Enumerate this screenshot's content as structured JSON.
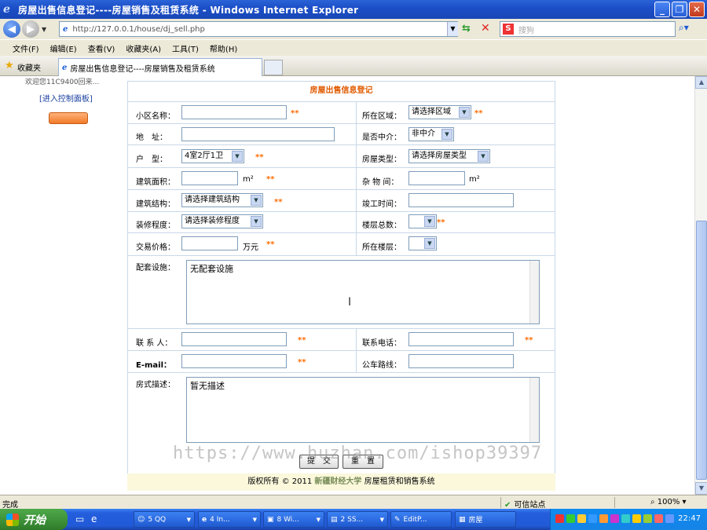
{
  "window": {
    "title": "房屋出售信息登记----房屋销售及租赁系统 - Windows Internet Explorer",
    "controls": [
      "_",
      "❐",
      "✕"
    ]
  },
  "toolbar": {
    "address": "http://127.0.0.1/house/dj_sell.php",
    "search_placeholder": "搜狗"
  },
  "menu": {
    "items": [
      "文件(F)",
      "编辑(E)",
      "查看(V)",
      "收藏夹(A)",
      "工具(T)",
      "帮助(H)"
    ]
  },
  "favorites": {
    "label": "收藏夹",
    "tab_title": "房屋出售信息登记----房屋销售及租赁系统"
  },
  "sidebar": {
    "welcome_text": "欢迎您11C9400回来...",
    "control_panel": "[进入控制面板]"
  },
  "form": {
    "title": "房屋出售信息登记",
    "required_mark": "**",
    "fields": {
      "community_name": "小区名称：",
      "region": "所在区域：",
      "region_value": "请选择区域",
      "address": "地　址：",
      "via_agent": "是否中介：",
      "via_agent_value": "非中介",
      "layout": "户　型：",
      "layout_value": "4室2厅1卫",
      "house_type": "房屋类型：",
      "house_type_value": "请选择房屋类型",
      "area": "建筑面积：",
      "area_unit": "m²",
      "storage": "杂 物 间：",
      "storage_unit": "m²",
      "structure": "建筑结构：",
      "structure_value": "请选择建筑结构",
      "completion_time": "竣工时间：",
      "decoration": "装修程度：",
      "decoration_value": "请选择装修程度",
      "total_floors": "楼层总数：",
      "price": "交易价格：",
      "price_unit": "万元",
      "floor": "所在楼层：",
      "facilities": "配套设施：",
      "facilities_value": "无配套设施",
      "contact": "联 系 人：",
      "phone": "联系电话：",
      "email": "E-mail：",
      "bus": "公车路线：",
      "description": "房式描述：",
      "description_value": "暂无描述"
    },
    "submit": "提　交",
    "reset": "重　置"
  },
  "footer": {
    "prefix": "版权所有 © 2011",
    "university": "新疆财经大学",
    "system": "房屋租赁和销售系统"
  },
  "watermark": "https://www.huzhan.com/ishop39397",
  "status": {
    "text": "完成",
    "zone": "可信站点",
    "zoom": "100%"
  },
  "taskbar": {
    "start": "开始",
    "tasks": [
      "5 QQ",
      "4 In...",
      "8 Wi...",
      "2 SS...",
      "EditP...",
      "房屋"
    ],
    "time": "22:47"
  }
}
